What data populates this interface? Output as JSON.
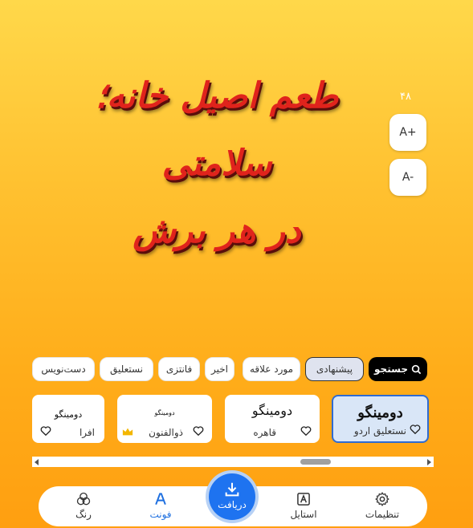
{
  "headline": {
    "line1": "طعم اصیل خانه؛ سلامتی",
    "line2": "در هر برش"
  },
  "font_size": {
    "value": "۴۸",
    "increase_label": "A+",
    "decrease_label": "A-"
  },
  "filters": {
    "search_label": "جستجو",
    "chips": [
      {
        "label": "پیشنهادی",
        "selected": true
      },
      {
        "label": "مورد علاقه",
        "selected": false
      },
      {
        "label": "اخیر",
        "selected": false
      },
      {
        "label": "فانتزی",
        "selected": false
      },
      {
        "label": "نستعلیق",
        "selected": false
      },
      {
        "label": "دست‌نویس",
        "selected": false
      }
    ]
  },
  "fonts": [
    {
      "preview": "دومینگو",
      "name": "نستعلیق اردو",
      "selected": true
    },
    {
      "preview": "دومینگو",
      "name": "قاهره",
      "selected": false
    },
    {
      "preview": "دومینگو",
      "name": "ذوالفنون",
      "premium": true,
      "selected": false
    },
    {
      "preview": "دومینگو",
      "name": "افرا",
      "selected": false
    }
  ],
  "nav": {
    "settings": "تنظیمات",
    "style": "استایل",
    "download": "دریافت",
    "font": "فونت",
    "color": "رنگ"
  },
  "colors": {
    "accent": "#1e73f0",
    "headline": "#e0231c",
    "background_top": "#ffd84a",
    "background_bottom": "#ff9f10"
  }
}
